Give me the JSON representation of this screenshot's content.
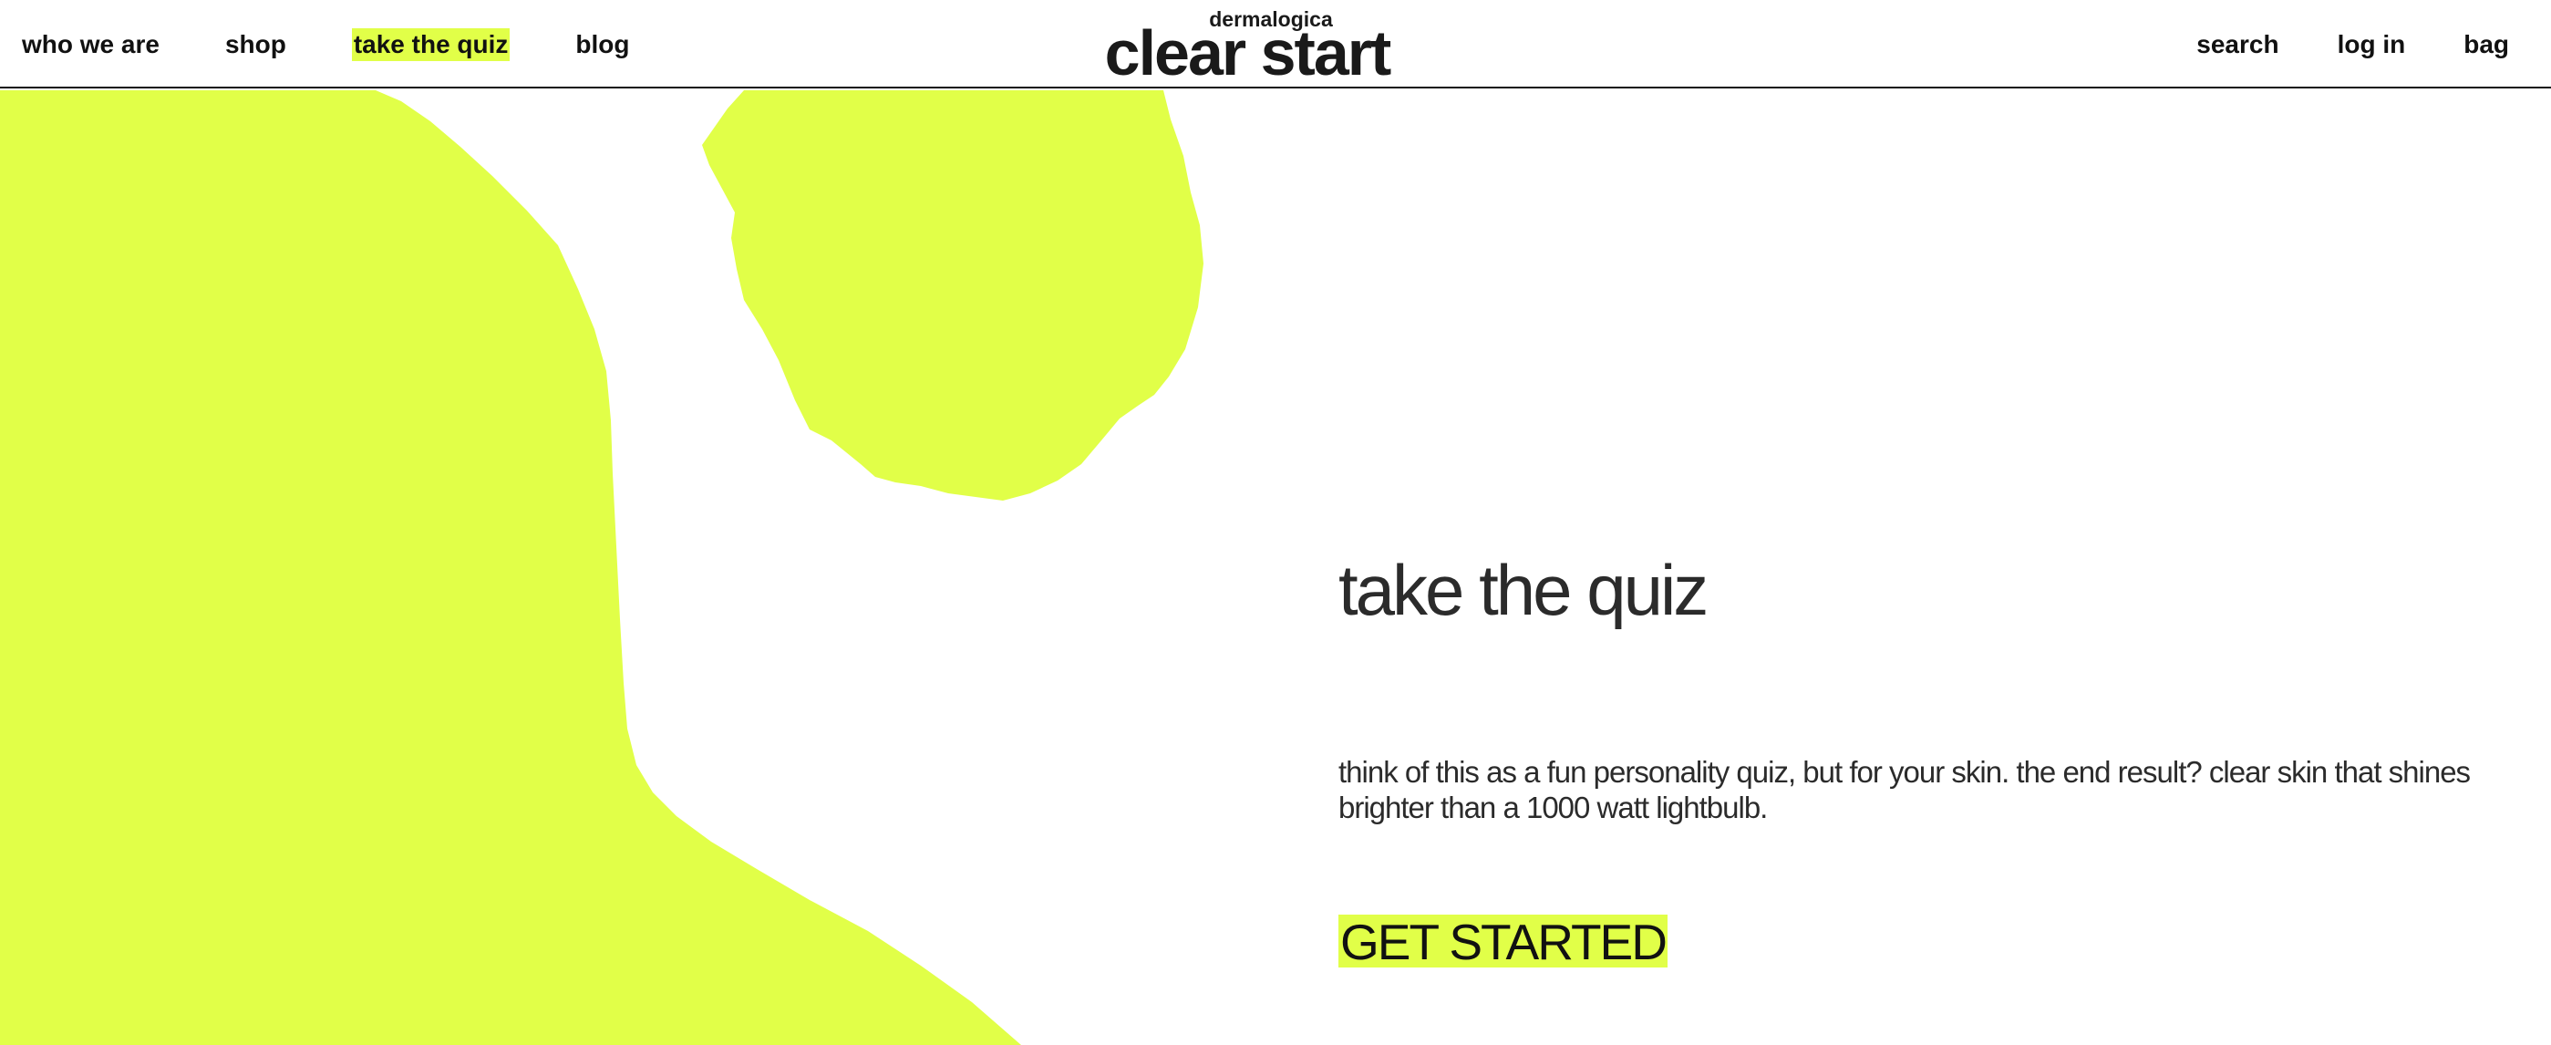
{
  "header": {
    "nav_left": {
      "who_we_are": "who we are",
      "shop": "shop",
      "take_the_quiz": "take the quiz",
      "blog": "blog"
    },
    "logo": {
      "top": "dermalogica",
      "main": "clear start"
    },
    "nav_right": {
      "search": "search",
      "log_in": "log in",
      "bag": "bag"
    }
  },
  "hero": {
    "title": "take the quiz",
    "description": "think of this as a fun personality quiz, but for your skin. the end result? clear skin that shines brighter than a 1000 watt lightbulb.",
    "cta_label": "GET STARTED"
  },
  "colors": {
    "accent": "#e1ff48",
    "text": "#2b2b2b",
    "background": "#ffffff"
  }
}
